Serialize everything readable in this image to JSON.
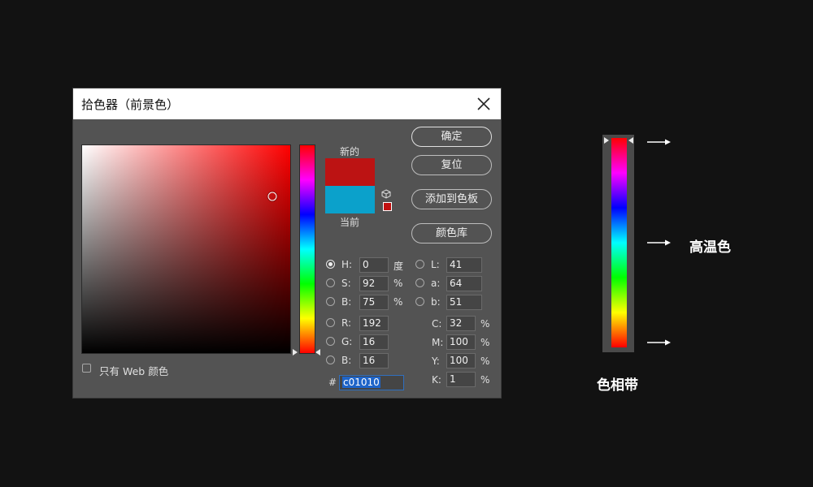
{
  "dialog": {
    "title": "拾色器（前景色）",
    "buttons": {
      "ok": "确定",
      "reset": "复位",
      "add_to_swatches": "添加到色板",
      "color_libraries": "颜色库"
    },
    "swatch_labels": {
      "new": "新的",
      "current": "当前"
    },
    "colors": {
      "new": "#bc1313",
      "current": "#0ba1cb",
      "hue_gradient": "red-to-red spectrum"
    },
    "fields": {
      "H": {
        "label": "H:",
        "value": "0",
        "unit": "度"
      },
      "S": {
        "label": "S:",
        "value": "92",
        "unit": "%"
      },
      "Bv": {
        "label": "B:",
        "value": "75",
        "unit": "%"
      },
      "R": {
        "label": "R:",
        "value": "192"
      },
      "G": {
        "label": "G:",
        "value": "16"
      },
      "Bc": {
        "label": "B:",
        "value": "16"
      },
      "L": {
        "label": "L:",
        "value": "41"
      },
      "a": {
        "label": "a:",
        "value": "64"
      },
      "b": {
        "label": "b:",
        "value": "51"
      },
      "C": {
        "label": "C:",
        "value": "32",
        "unit": "%"
      },
      "M": {
        "label": "M:",
        "value": "100",
        "unit": "%"
      },
      "Y": {
        "label": "Y:",
        "value": "100",
        "unit": "%"
      },
      "K": {
        "label": "K:",
        "value": "1",
        "unit": "%"
      }
    },
    "hex": {
      "label": "#",
      "value": "c01010"
    },
    "web_only": {
      "label": "只有 Web 颜色",
      "checked": false
    },
    "selected_model": "H",
    "icons": {
      "close": "close-icon",
      "gamut": "cube-icon"
    }
  },
  "side": {
    "label_high_temp": "高温色",
    "label_hue_band": "色相带"
  }
}
